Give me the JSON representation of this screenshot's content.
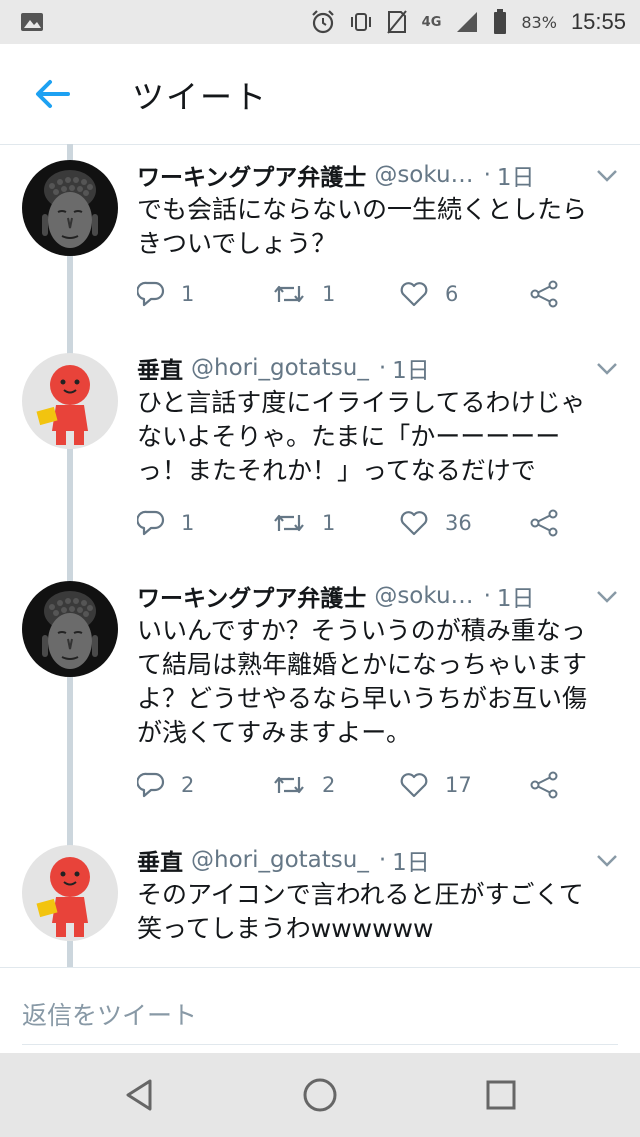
{
  "status_bar": {
    "network": "4G",
    "battery": "83%",
    "time": "15:55"
  },
  "header": {
    "title": "ツイート"
  },
  "tweets": [
    {
      "name": "ワーキングプア弁護士",
      "handle": "@soku…",
      "time": "1日",
      "text": "でも会話にならないの一生続くとしたら\nきついでしょう？",
      "replies": "1",
      "retweets": "1",
      "likes": "6"
    },
    {
      "name": "垂直",
      "handle": "@hori_gotatsu_",
      "time": "1日",
      "text": "ひと言話す度にイライラしてるわけじゃ\nないよそりゃ。たまに「かーーーーー\nっ！またそれか！」ってなるだけで",
      "replies": "1",
      "retweets": "1",
      "likes": "36"
    },
    {
      "name": "ワーキングプア弁護士",
      "handle": "@soku…",
      "time": "1日",
      "text": "いいんですか？そういうのが積み重なっ\nて結局は熟年離婚とかになっちゃいます\nよ？どうせやるなら早いうちがお互い傷\nが浅くてすみますよー。",
      "replies": "2",
      "retweets": "2",
      "likes": "17"
    },
    {
      "name": "垂直",
      "handle": "@hori_gotatsu_",
      "time": "1日",
      "text": "そのアイコンで言われると圧がすごくて\n笑ってしまうわwwwwww"
    }
  ],
  "reply_bar": {
    "placeholder": "返信をツイート"
  },
  "colors": {
    "accent": "#1da1f2",
    "muted": "#657786",
    "thread_line": "#ccd6dd"
  },
  "icons": {
    "back": "arrow-left-icon",
    "reply": "reply-icon",
    "retweet": "retweet-icon",
    "like": "heart-icon",
    "share": "share-icon",
    "more": "chevron-down-icon"
  }
}
